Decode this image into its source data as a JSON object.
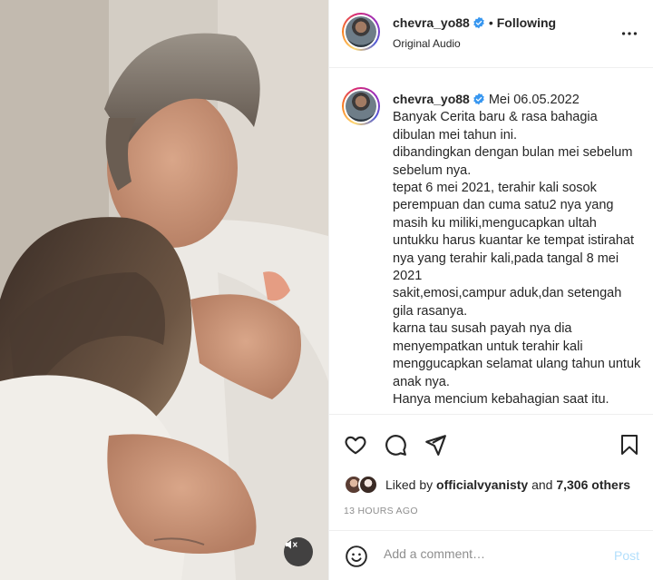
{
  "post": {
    "username": "chevra_yo88",
    "separator": "•",
    "follow_status": "Following",
    "audio_label": "Original Audio",
    "verified_icon": "verified-badge-icon",
    "more_icon": "more-options-icon"
  },
  "caption": {
    "username": "chevra_yo88",
    "date": "Mei 06.05.2022",
    "text": "Banyak Cerita baru & rasa bahagia dibulan mei tahun ini.\ndibandingkan dengan bulan mei sebelum sebelum nya.\ntepat 6 mei 2021, terahir kali sosok perempuan dan cuma satu2 nya yang masih ku miliki,mengucapkan ultah untukku harus kuantar ke tempat istirahat nya yang terahir kali,pada tangal 8 mei 2021\nsakit,emosi,campur aduk,dan setengah gila rasanya.\nkarna tau susah payah nya dia menyempatkan untuk terahir kali menggucapkan selamat ulang tahun untuk anak nya.\nHanya mencium kebahagian saat itu."
  },
  "actions": {
    "like_icon": "heart-icon",
    "comment_icon": "comment-icon",
    "share_icon": "share-icon",
    "save_icon": "bookmark-icon"
  },
  "likes": {
    "prefix": "Liked by",
    "liker": "officialvyanisty",
    "conjunction": "and",
    "count": "7,306 others"
  },
  "timestamp": "13 HOURS AGO",
  "comment": {
    "placeholder": "Add a comment…",
    "post_label": "Post",
    "emoji_icon": "emoji-icon"
  },
  "media": {
    "mute_icon": "speaker-muted-icon"
  },
  "colors": {
    "verified": "#3897f0",
    "post_disabled": "#b2dffc",
    "secondary_text": "#8e8e8e"
  }
}
